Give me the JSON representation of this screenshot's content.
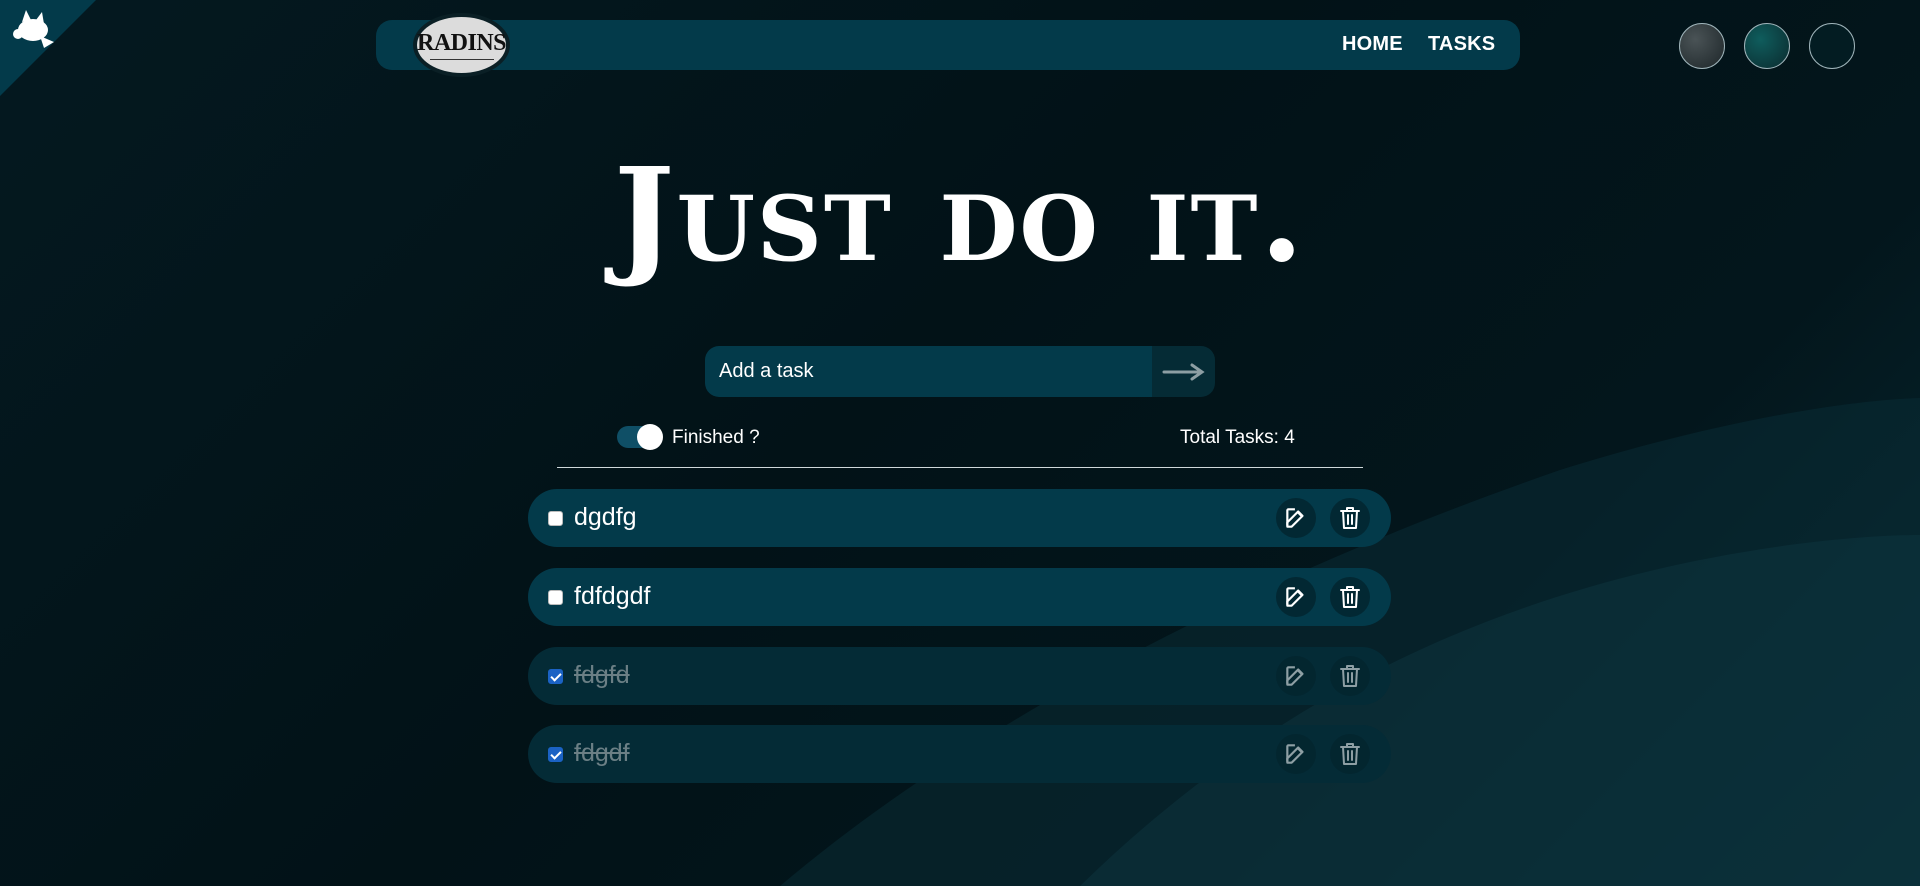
{
  "header": {
    "logo_text": "RADINS",
    "nav": [
      {
        "label": "HOME"
      },
      {
        "label": "TASKS"
      }
    ],
    "theme_buttons": [
      "theme-gray",
      "theme-teal",
      "theme-dark"
    ]
  },
  "hero": {
    "title": "Just do it."
  },
  "add_task": {
    "placeholder": "Add a task",
    "submit_icon": "arrow-right-icon"
  },
  "filter": {
    "toggle_label": "Finished ?",
    "toggle_on": true,
    "total_label": "Total Tasks: 4"
  },
  "tasks": [
    {
      "title": "dgdfg",
      "done": false
    },
    {
      "title": "fdfdgdf",
      "done": false
    },
    {
      "title": "fdgfd",
      "done": true
    },
    {
      "title": "fdgdf",
      "done": true
    }
  ],
  "colors": {
    "accent": "#033a4a",
    "background": "#021217",
    "checked": "#1b62c4"
  }
}
